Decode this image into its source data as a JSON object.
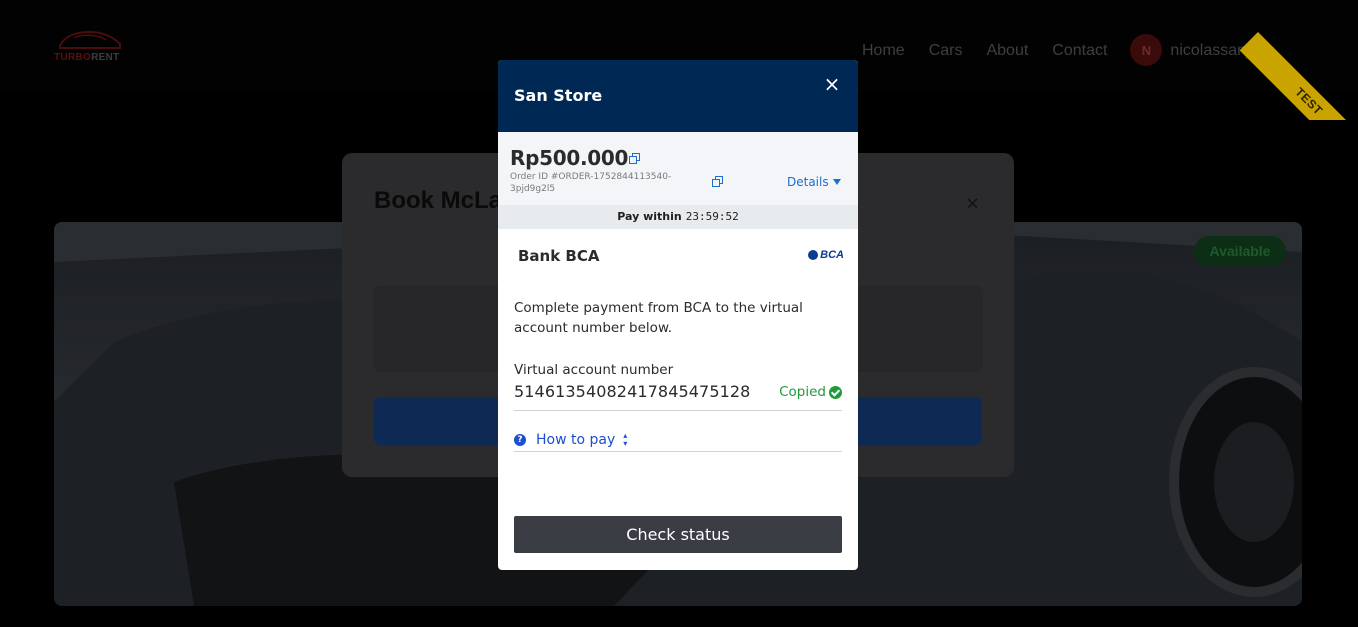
{
  "site": {
    "logo": {
      "text_main": "TURBO",
      "text_accent": "RENT"
    },
    "nav": {
      "items": [
        "Home",
        "Cars",
        "About",
        "Contact"
      ],
      "user_initial": "N",
      "username": "nicolassanjaya"
    },
    "ribbon": "TEST",
    "car": {
      "status_badge": "Available"
    },
    "book_modal": {
      "title": "Book McLaren Senna",
      "close": "×"
    }
  },
  "payment": {
    "store_name": "San Store",
    "close": "×",
    "amount": "Rp500.000",
    "order_id": "Order ID #ORDER-1752844113540-3pjd9g2l5",
    "details_label": "Details",
    "pay_within_label": "Pay within",
    "timer": "23:59:52",
    "bank_name": "Bank BCA",
    "bank_logo_text": "BCA",
    "instruction": "Complete payment from BCA to the virtual account number below.",
    "va_label": "Virtual account number",
    "va_number": "51461354082417845475128",
    "copied_label": "Copied",
    "how_to_pay": "How to pay",
    "check_status": "Check status"
  },
  "colors": {
    "header_navy": "#002855",
    "link_blue": "#1a6fd1",
    "success_green": "#1f9b3a",
    "button_dark": "#3b3d45",
    "ribbon_yellow": "#c9a400"
  }
}
